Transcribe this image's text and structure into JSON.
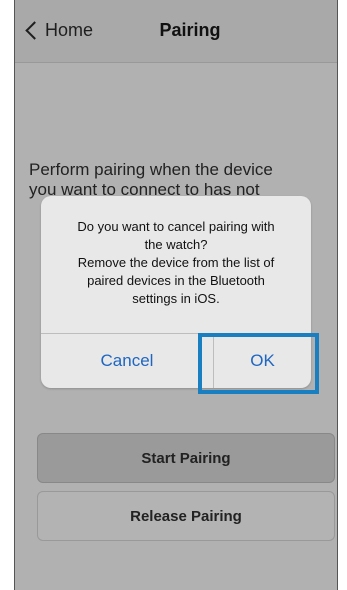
{
  "navbar": {
    "back_label": "Home",
    "title": "Pairing"
  },
  "background": {
    "instruction_lines": [
      "Perform pairing when the device",
      "you want to connect to has not"
    ],
    "start_pairing_label": "Start Pairing",
    "release_pairing_label": "Release Pairing"
  },
  "alert": {
    "message_lines": [
      "Do you want to cancel pairing with",
      "the watch?",
      "Remove the device from the list of",
      "paired devices in the Bluetooth",
      "settings in iOS."
    ],
    "cancel_label": "Cancel",
    "ok_label": "OK"
  },
  "colors": {
    "accent": "#1e66c2",
    "highlight": "#1a7fc0",
    "overlay": "#b1b1b1"
  }
}
